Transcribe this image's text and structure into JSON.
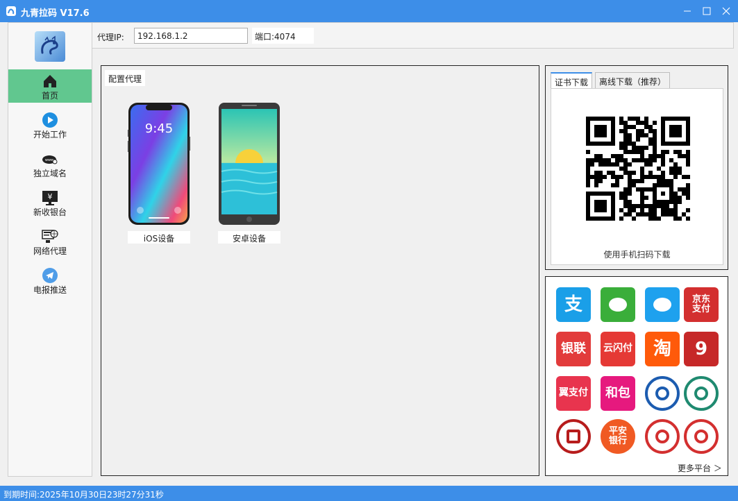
{
  "window": {
    "title": "九青拉码 V17.6",
    "accent_color": "#3d8ee8",
    "controls": [
      "minimize-icon",
      "maximize-icon",
      "close-icon"
    ]
  },
  "sidebar": {
    "active_color": "#61c78f",
    "items": [
      {
        "label": "首页",
        "icon": "home-icon",
        "active": true
      },
      {
        "label": "开始工作",
        "icon": "play-icon",
        "active": false
      },
      {
        "label": "独立域名",
        "icon": "domain-icon",
        "active": false
      },
      {
        "label": "新收银台",
        "icon": "cashier-icon",
        "active": false
      },
      {
        "label": "网络代理",
        "icon": "network-proxy-icon",
        "active": false
      },
      {
        "label": "电报推送",
        "icon": "telegram-icon",
        "active": false
      }
    ]
  },
  "proxy": {
    "ip_label": "代理IP:",
    "ip_value": "192.168.1.2",
    "port_text": "端口:4074"
  },
  "config": {
    "caption": "配置代理",
    "devices": [
      {
        "label": "iOS设备",
        "screen_time": "9:45"
      },
      {
        "label": "安卓设备"
      }
    ]
  },
  "cert": {
    "tabs": [
      {
        "label": "证书下载",
        "active": true
      },
      {
        "label": "离线下载（推荐）",
        "active": false
      }
    ],
    "scan_tip": "使用手机扫码下载"
  },
  "payments": {
    "items": [
      {
        "name": "alipay",
        "text": "支",
        "color": "#1a9fe8"
      },
      {
        "name": "wechat-pay",
        "text": "",
        "color": "#3aae3a"
      },
      {
        "name": "qq-wallet",
        "text": "",
        "color": "#1ea1ee"
      },
      {
        "name": "jd-pay",
        "text": "京东支付",
        "color": "#d32f2f"
      },
      {
        "name": "unionpay",
        "text": "银联",
        "color": "#e23b3b"
      },
      {
        "name": "cloud-quickpass",
        "text": "云闪付",
        "color": "#e53935"
      },
      {
        "name": "taobao",
        "text": "淘",
        "color": "#ff5a0a"
      },
      {
        "name": "app-9",
        "text": "9",
        "color": "#c62828"
      },
      {
        "name": "best-pay",
        "text": "翼支付",
        "color": "#e8344e"
      },
      {
        "name": "hebao",
        "text": "和包",
        "color": "#e6197e"
      },
      {
        "name": "ccb",
        "text": "",
        "color": "#1c5cb0"
      },
      {
        "name": "abc",
        "text": "",
        "color": "#1f8a70"
      },
      {
        "name": "boc",
        "text": "",
        "color": "#b71c1c"
      },
      {
        "name": "ping-an-bank",
        "text": "平安银行",
        "color": "#f05a23"
      },
      {
        "name": "icbc",
        "text": "",
        "color": "#d32f2f"
      },
      {
        "name": "cmb",
        "text": "",
        "color": "#d32f2f"
      }
    ],
    "more_label": "更多平台 ＞"
  },
  "status": {
    "expire_text": "到期时间:2025年10月30日23时27分31秒"
  }
}
